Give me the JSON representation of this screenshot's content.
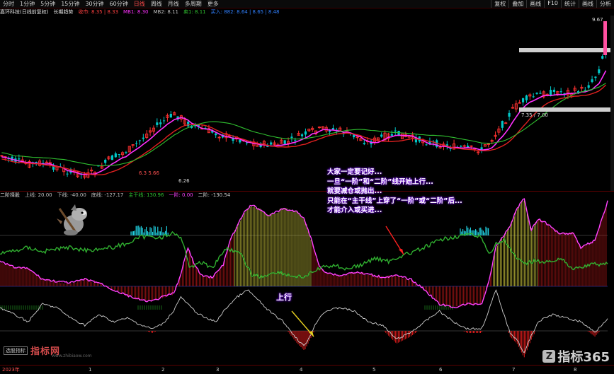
{
  "toolbar": {
    "tabs": [
      "分时",
      "1分钟",
      "5分钟",
      "15分钟",
      "30分钟",
      "60分钟",
      "日线",
      "周线",
      "月线",
      "多周期",
      "更多"
    ],
    "active_tab": "日线",
    "right_tabs": [
      "复权",
      "叠加",
      "画线",
      "F10",
      "统计",
      "画线",
      "分析"
    ]
  },
  "legend": {
    "stock": "嘉环科技(日线前复权)",
    "indicator": "长期趋势",
    "items": [
      "收市: 8.35 | 8.33",
      "MB1: 8.30",
      "MB2: 8.11",
      "卖1: 8.11",
      "买入: 882: 8.64 | 8.65 | 8.48"
    ]
  },
  "price_labels": {
    "high": "9.67",
    "mid": "7.35 / 7.00",
    "low": "6.26",
    "low_left": "6.3 5.66"
  },
  "indicator_bar": {
    "name": "二阶择股",
    "items": [
      "上线: 20.00",
      "下线: -40.00",
      "底线: -127.17",
      "主干线: 130.96",
      "一阶: 0.00",
      "二阶: -130.54"
    ]
  },
  "annotation": {
    "lines": [
      "大家一定要记好...",
      "一旦“一阶”和“二阶”线开始上行...",
      "就要减仓或抛出...",
      "只能在“主干线”上穿了“一阶”或“二阶”后...",
      "才能介入或买进..."
    ],
    "up_label": "上行"
  },
  "watermark_left": {
    "button": "选股指标",
    "logo": "指标网",
    "url": "www.zhibiaow.com"
  },
  "watermark_right": {
    "mark": "Z",
    "text": "指标365"
  },
  "axis": {
    "left_label": "2023年",
    "months": [
      "1",
      "2",
      "3",
      "4",
      "5",
      "6",
      "7",
      "8"
    ]
  },
  "colors": {
    "up": "#ff3030",
    "down": "#00c8c8",
    "ma_pink": "#ff30ff",
    "ma_red": "#e02020",
    "ma_green": "#30c030",
    "main_line": "#30b030",
    "stage1": "#ff40ff",
    "stage2": "#d0d0d0"
  }
}
